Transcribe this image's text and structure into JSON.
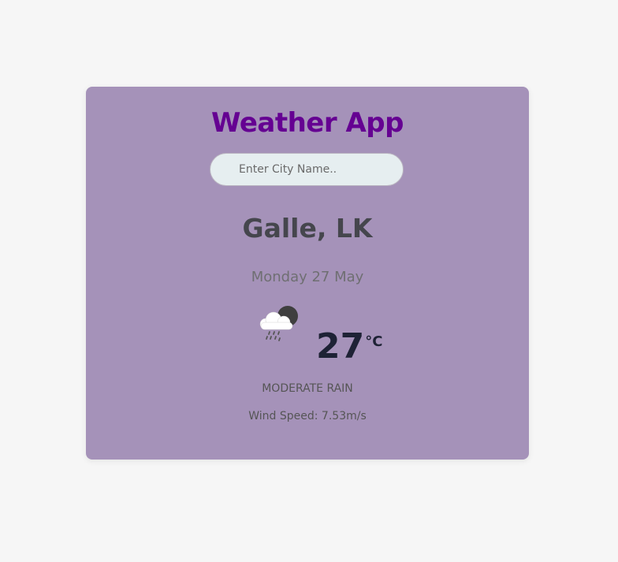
{
  "app": {
    "title": "Weather App"
  },
  "search": {
    "placeholder": "Enter City Name.."
  },
  "location": {
    "city": "Galle, LK"
  },
  "date": "Monday 27 May",
  "weather": {
    "icon": "rain-cloud-icon",
    "temperature": "27",
    "unit": "°C",
    "description": "MODERATE RAIN",
    "wind_speed": "Wind Speed: 7.53m/s"
  },
  "colors": {
    "page_bg": "#f6f6f6",
    "card_bg": "#a592b9",
    "title": "#650192",
    "temperature": "#1e2235"
  }
}
